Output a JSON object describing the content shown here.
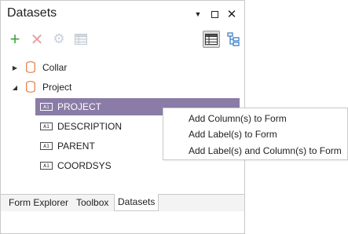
{
  "panel": {
    "title": "Datasets",
    "window_buttons": [
      "pin-icon",
      "maximize-icon",
      "close-icon"
    ]
  },
  "toolbar": {
    "add_icon": "plus-icon",
    "delete_icon": "x-icon",
    "settings_icon": "gear-icon",
    "grid_icon": "grid-icon",
    "view_table_icon": "table-view-icon",
    "view_tree_icon": "tree-view-icon"
  },
  "tree": {
    "datasets": [
      {
        "label": "Collar",
        "expanded": false
      },
      {
        "label": "Project",
        "expanded": true
      }
    ],
    "columns": [
      {
        "label": "PROJECT",
        "selected": true,
        "icon_text": "A1"
      },
      {
        "label": "DESCRIPTION",
        "selected": false,
        "icon_text": "A1"
      },
      {
        "label": "PARENT",
        "selected": false,
        "icon_text": "A1"
      },
      {
        "label": "COORDSYS",
        "selected": false,
        "icon_text": "A1"
      }
    ]
  },
  "context_menu": {
    "items": [
      "Add Column(s) to Form",
      "Add Label(s) to Form",
      "Add Label(s) and Column(s) to Form"
    ]
  },
  "bottom_tabs": [
    {
      "label": "Form Explorer",
      "active": false
    },
    {
      "label": "Toolbox",
      "active": false
    },
    {
      "label": "Datasets",
      "active": true
    }
  ],
  "colors": {
    "selection": "#8a7ca6",
    "add_green": "#3aa540",
    "database_orange": "#e07a3a",
    "tree_view_blue": "#3c7fc4"
  }
}
